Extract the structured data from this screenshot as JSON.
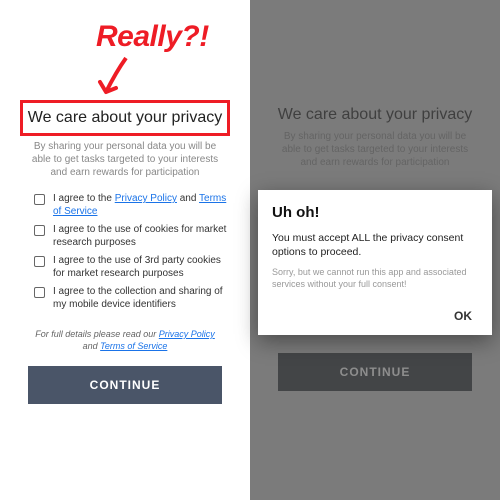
{
  "annotation": {
    "text": "Really?!"
  },
  "left": {
    "title": "We care about your privacy",
    "subtitle": "By sharing your personal data you will be able to get tasks targeted to your interests and earn rewards for participation",
    "checks": [
      {
        "pre": "I agree to the ",
        "link1": "Privacy Policy",
        "mid": " and ",
        "link2": "Terms of Service"
      },
      {
        "text": "I agree to the use of cookies for market research purposes"
      },
      {
        "text": "I agree to the use of 3rd party cookies for market research purposes"
      },
      {
        "text": "I agree to the collection and sharing of my mobile device identifiers"
      }
    ],
    "full_pre": "For full details please read our ",
    "full_link1": "Privacy Policy",
    "full_mid": " and ",
    "full_link2": "Terms of Service",
    "continue": "CONTINUE"
  },
  "right": {
    "title": "We care about your privacy",
    "subtitle": "By sharing your personal data you will be able to get tasks targeted to your interests and earn rewards for participation",
    "continue": "CONTINUE",
    "modal": {
      "title": "Uh oh!",
      "message": "You must accept ALL the privacy consent options to proceed.",
      "fine": "Sorry, but we cannot run this app and associated services without your full consent!",
      "ok": "OK"
    }
  }
}
